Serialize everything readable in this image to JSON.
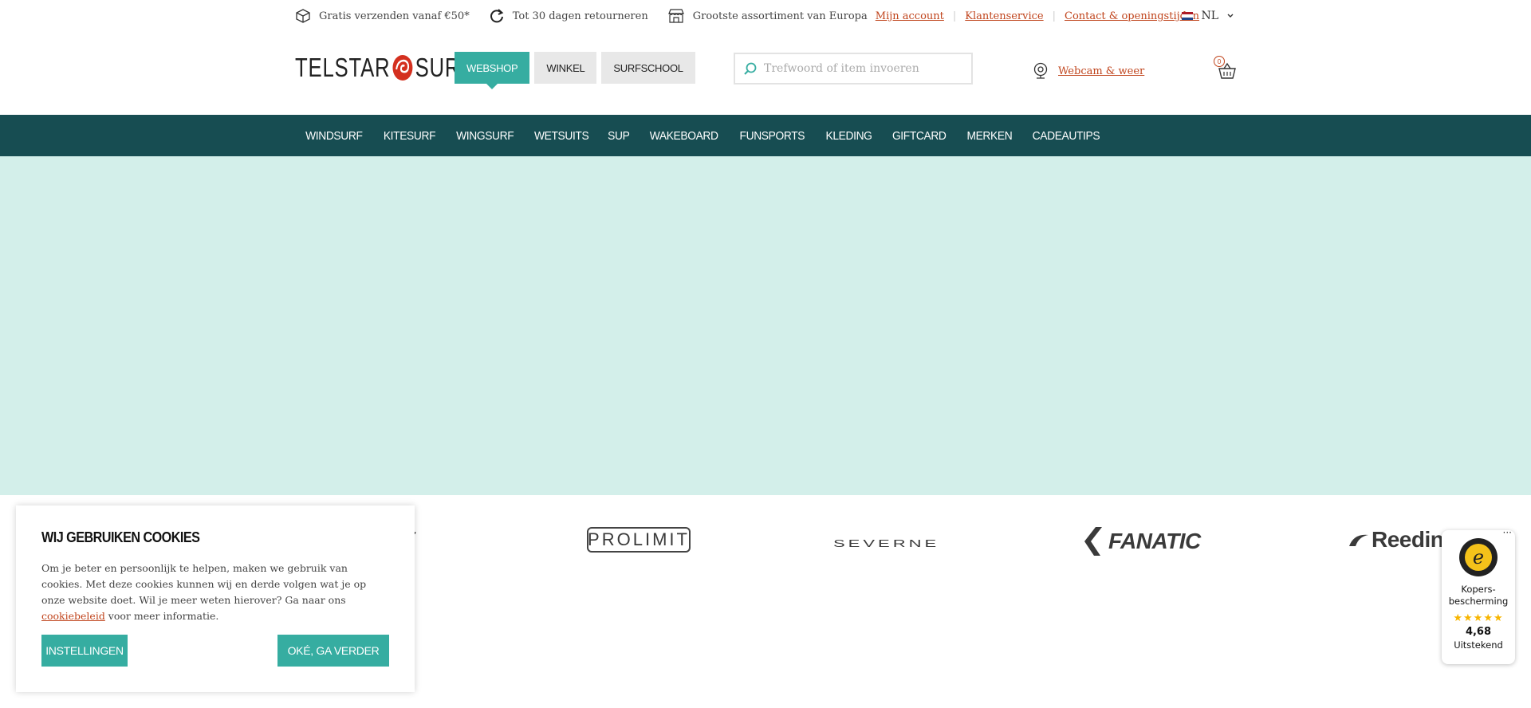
{
  "usp_bar": {
    "items": [
      {
        "icon": "box-icon",
        "text": "Gratis verzenden vanaf €50*"
      },
      {
        "icon": "return-arrow-icon",
        "text": "Tot 30 dagen retourneren"
      },
      {
        "icon": "store-icon",
        "text": "Grootste assortiment van Europa"
      }
    ],
    "links": [
      "Mijn account",
      "Klantenservice",
      "Contact & openingstijden"
    ],
    "language": "NL"
  },
  "header": {
    "logo": {
      "left": "TELSTAR",
      "right": "SURF"
    },
    "store_tabs": [
      "WEBSHOP",
      "WINKEL",
      "SURFSCHOOL"
    ],
    "active_tab": "WEBSHOP",
    "search_placeholder": "Trefwoord of item invoeren",
    "webcam_link": "Webcam & weer",
    "cart_count": "0"
  },
  "main_nav": [
    "WINDSURF",
    "KITESURF",
    "WINGSURF",
    "WETSUITS",
    "SUP",
    "WAKEBOARD",
    "FUNSPORTS",
    "KLEDING",
    "GIFTCARD",
    "MERKEN",
    "CADEAUTIPS"
  ],
  "brands": [
    "F",
    "PROLIMIT",
    "SEVERNE",
    "FANATIC",
    "Reedin"
  ],
  "cookie": {
    "title": "WIJ GEBRUIKEN COOKIES",
    "text_before": "Om je beter en persoonlijk te helpen, maken we gebruik van cookies. Met deze cookies kunnen wij en derde volgen wat je op onze website doet. Wil je meer weten hierover? Ga naar ons ",
    "link": "cookiebeleid",
    "text_after": " voor meer informatie.",
    "settings_button": "INSTELLINGEN",
    "ok_button": "OKÉ, GA VERDER"
  },
  "trusted_shops": {
    "more": "···",
    "label": "Kopers-bescherming",
    "label_line1": "Kopers-",
    "label_line2": "bescherming",
    "stars": "★★★★★",
    "rating": 4.68,
    "score": "4,68",
    "verdict": "Uitstekend"
  },
  "colors": {
    "accent": "#36ada1",
    "nav_bg": "#174d52",
    "hero_bg": "#d3efea",
    "link": "#c0441c"
  }
}
